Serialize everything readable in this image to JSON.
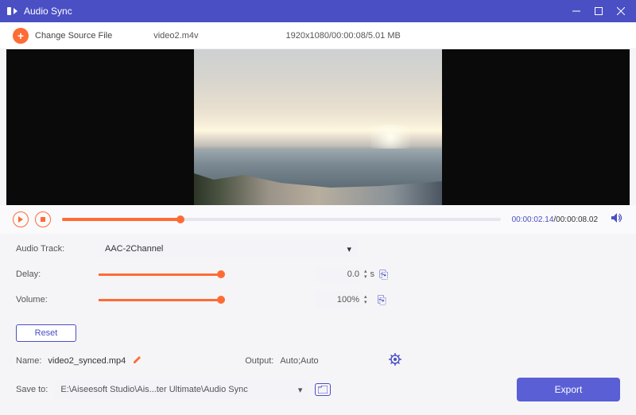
{
  "app": {
    "title": "Audio Sync"
  },
  "toolbar": {
    "change_source_label": "Change Source File",
    "filename": "video2.m4v",
    "file_info": "1920x1080/00:00:08/5.01 MB"
  },
  "player": {
    "current_time": "00:00:02.14",
    "total_time": "00:00:08.02",
    "separator": "/"
  },
  "controls": {
    "audio_track_label": "Audio Track:",
    "audio_track_value": "AAC-2Channel",
    "delay_label": "Delay:",
    "delay_value": "0.0",
    "delay_unit": "s",
    "volume_label": "Volume:",
    "volume_value": "100%",
    "reset_label": "Reset"
  },
  "output": {
    "name_label": "Name:",
    "name_value": "video2_synced.mp4",
    "output_label": "Output:",
    "output_value": "Auto;Auto",
    "saveto_label": "Save to:",
    "saveto_value": "E:\\Aiseesoft Studio\\Ais...ter Ultimate\\Audio Sync",
    "export_label": "Export"
  }
}
